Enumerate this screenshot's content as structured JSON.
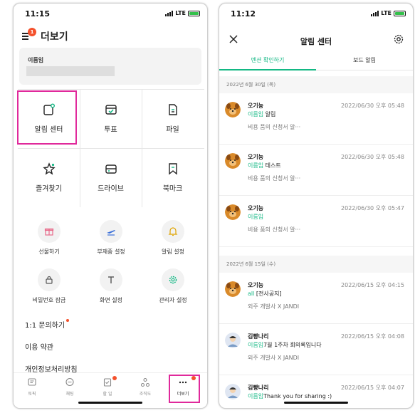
{
  "status_left": {
    "time": "11:15",
    "carrier": "LTE"
  },
  "status_right": {
    "time": "11:12",
    "carrier": "LTE"
  },
  "more": {
    "title": "더보기",
    "menu_badge": "1",
    "profile_name": "이름임",
    "grid": [
      {
        "label": "알림 센터",
        "icon": "notification-center-icon"
      },
      {
        "label": "투표",
        "icon": "vote-icon"
      },
      {
        "label": "파일",
        "icon": "file-icon"
      },
      {
        "label": "즐겨찾기",
        "icon": "star-icon"
      },
      {
        "label": "드라이브",
        "icon": "drive-icon"
      },
      {
        "label": "북마크",
        "icon": "bookmark-icon"
      }
    ],
    "tools": [
      {
        "label": "선물하기",
        "icon": "gift-icon",
        "color": "#e86a8a"
      },
      {
        "label": "부재중 설정",
        "icon": "airplane-icon",
        "color": "#3a6fd8"
      },
      {
        "label": "알림 설정",
        "icon": "bell-icon",
        "color": "#e0a400"
      },
      {
        "label": "비밀번호 잠금",
        "icon": "lock-icon",
        "color": "#555555"
      },
      {
        "label": "화면 설정",
        "icon": "text-icon",
        "color": "#555555"
      },
      {
        "label": "관리자 설정",
        "icon": "gear-icon",
        "color": "#13b884"
      }
    ],
    "links": [
      "1:1 문의하기",
      "이용 약관",
      "개인정보처리방침"
    ],
    "tabs": [
      "토픽",
      "채팅",
      "할 일",
      "조직도",
      "더보기"
    ]
  },
  "noti_center": {
    "title": "알림 센터",
    "tabs": [
      "멘션 확인하기",
      "보드 알림"
    ],
    "accent": "#13b884",
    "groups": [
      {
        "date": "2022년 6월 30일 (목)",
        "items": [
          {
            "sender": "오기능",
            "time": "2022/06/30 오후 05:48",
            "mention": "이름임",
            "text": " 알림",
            "topic": "비용 품의 신청서 알···",
            "avatar": "dog-avatar"
          },
          {
            "sender": "오기능",
            "time": "2022/06/30 오후 05:48",
            "mention": "이름임",
            "text": " 테스트",
            "topic": "비용 품의 신청서 알···",
            "avatar": "dog-avatar"
          },
          {
            "sender": "오기능",
            "time": "2022/06/30 오후 05:47",
            "mention": "이름임",
            "text": "",
            "topic": "비용 품의 신청서 알···",
            "avatar": "dog-avatar"
          }
        ]
      },
      {
        "date": "2022년 6월 15일 (수)",
        "items": [
          {
            "sender": "오기능",
            "time": "2022/06/15 오후 04:15",
            "mention": "all",
            "text": " [전사공지]",
            "topic": "외주 개발사 X JANDI",
            "avatar": "dog-avatar"
          },
          {
            "sender": "김빵나리",
            "time": "2022/06/15 오후 04:08",
            "mention": "이름임",
            "text": "7월 1주차 회의록입니다",
            "topic": "외주 개발사 X JANDI",
            "avatar": "person-avatar"
          },
          {
            "sender": "김빵나리",
            "time": "2022/06/15 오후 04:07",
            "mention": "이름임",
            "text": "Thank you for sharing :)",
            "topic": "",
            "avatar": "person-avatar"
          }
        ]
      }
    ]
  }
}
